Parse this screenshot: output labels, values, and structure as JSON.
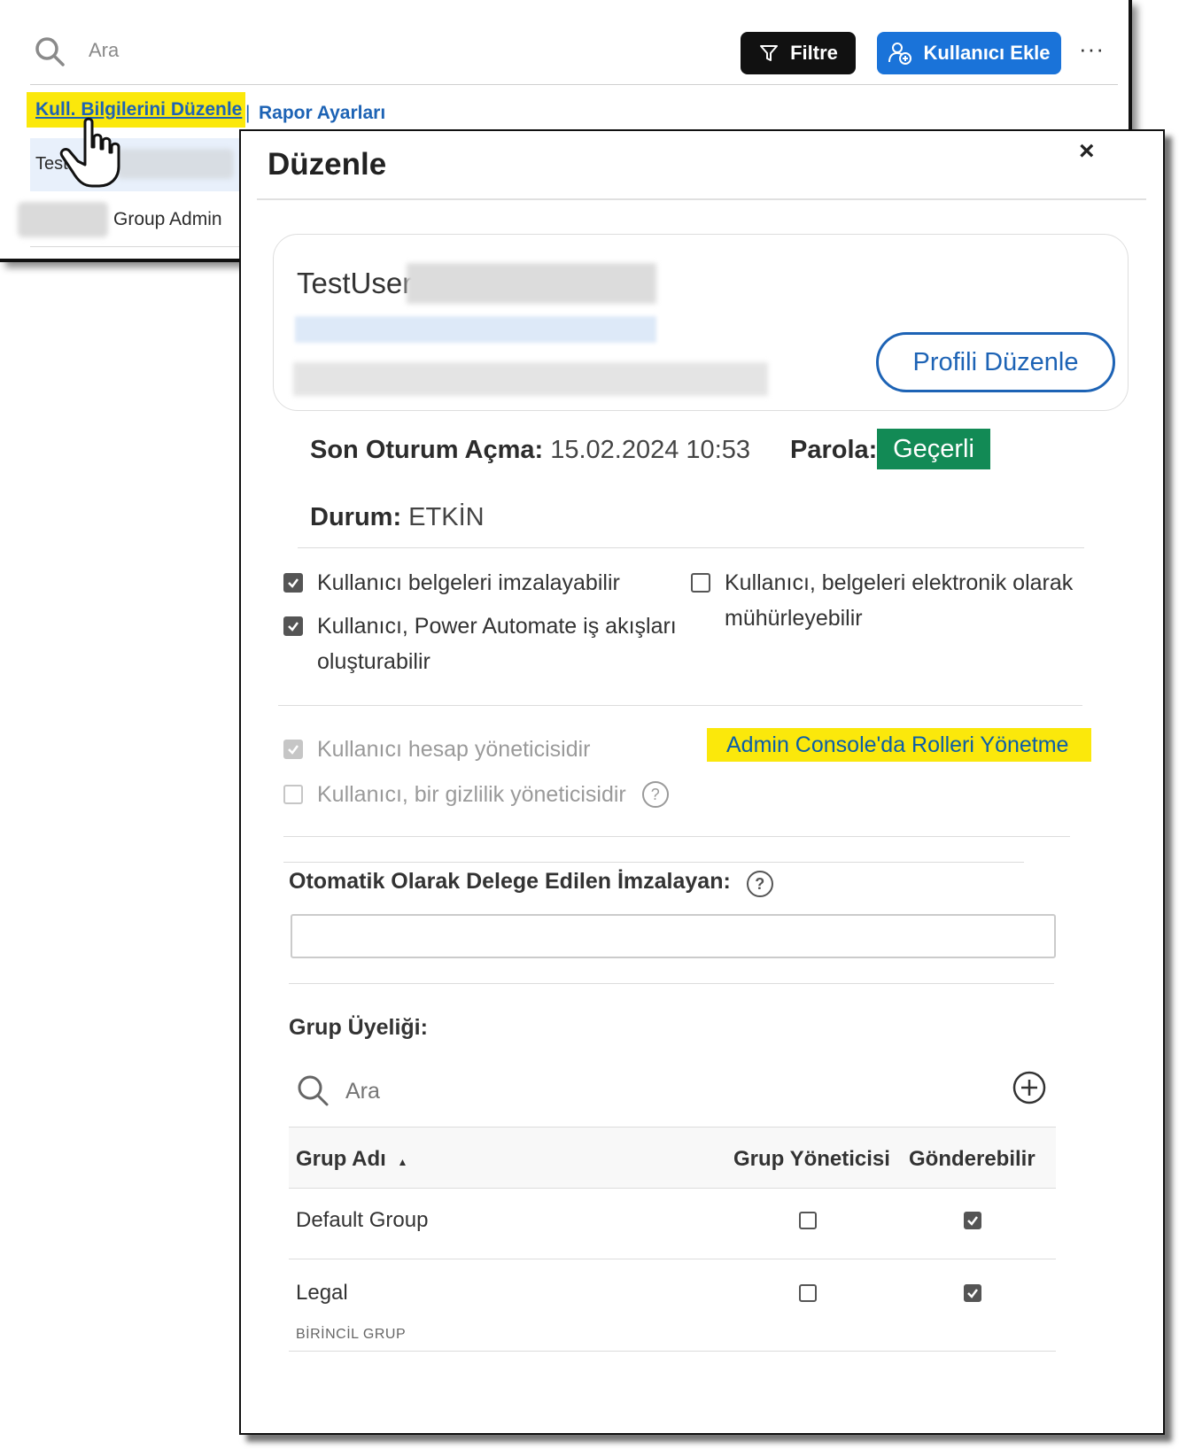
{
  "background_page": {
    "search_placeholder": "Ara",
    "filter_button": "Filtre",
    "add_user_button": "Kullanıcı Ekle",
    "more_label": "···",
    "edit_user_link": "Kull. Bilgilerini Düzenle",
    "separator": "|",
    "report_settings_link": "Rapor Ayarları",
    "row1_text": "Test",
    "row2_role": "Group Admin"
  },
  "modal": {
    "title": "Düzenle",
    "close_label": "×",
    "profile": {
      "name": "TestUser",
      "edit_profile_button": "Profili Düzenle"
    },
    "last_login_label": "Son Oturum Açma:",
    "last_login_value": "15.02.2024 10:53",
    "password_label": "Parola:",
    "password_status": "Geçerli",
    "status_label": "Durum:",
    "status_value": "ETKİN",
    "permissions": [
      {
        "label": "Kullanıcı belgeleri imzalayabilir",
        "checked": true
      },
      {
        "label": "Kullanıcı, belgeleri elektronik olarak mühürleyebilir",
        "checked": false
      },
      {
        "label": "Kullanıcı, Power Automate iş akışları oluşturabilir",
        "checked": true
      }
    ],
    "roles": [
      {
        "label": "Kullanıcı hesap yöneticisidir",
        "checked": true,
        "disabled": true
      },
      {
        "label": "Kullanıcı, bir gizlilik yöneticisidir",
        "checked": false,
        "disabled": true
      }
    ],
    "manage_roles_link": "Admin Console'da Rolleri Yönetme",
    "delegate_label": "Otomatik Olarak Delege Edilen İmzalayan:",
    "delegate_value": "",
    "group_membership_label": "Grup Üyeliği:",
    "group_search_placeholder": "Ara",
    "group_table": {
      "columns": [
        "Grup Adı",
        "Grup Yöneticisi",
        "Gönderebilir"
      ],
      "sort_indicator": "▲",
      "rows": [
        {
          "name": "Default Group",
          "subtitle": "",
          "group_admin": false,
          "can_send": true
        },
        {
          "name": "Legal",
          "subtitle": "BİRİNCİL GRUP",
          "group_admin": false,
          "can_send": true
        }
      ]
    }
  },
  "colors": {
    "accent_blue": "#1d63b5",
    "add_button_blue": "#1a73d9",
    "highlight_yellow": "#fbe80b",
    "valid_green": "#128a55"
  },
  "icons": [
    "search-icon",
    "filter-icon",
    "add-user-icon",
    "more-icon",
    "hand-cursor-icon",
    "close-icon",
    "help-icon",
    "plus-circle-icon",
    "checkmark-icon"
  ]
}
